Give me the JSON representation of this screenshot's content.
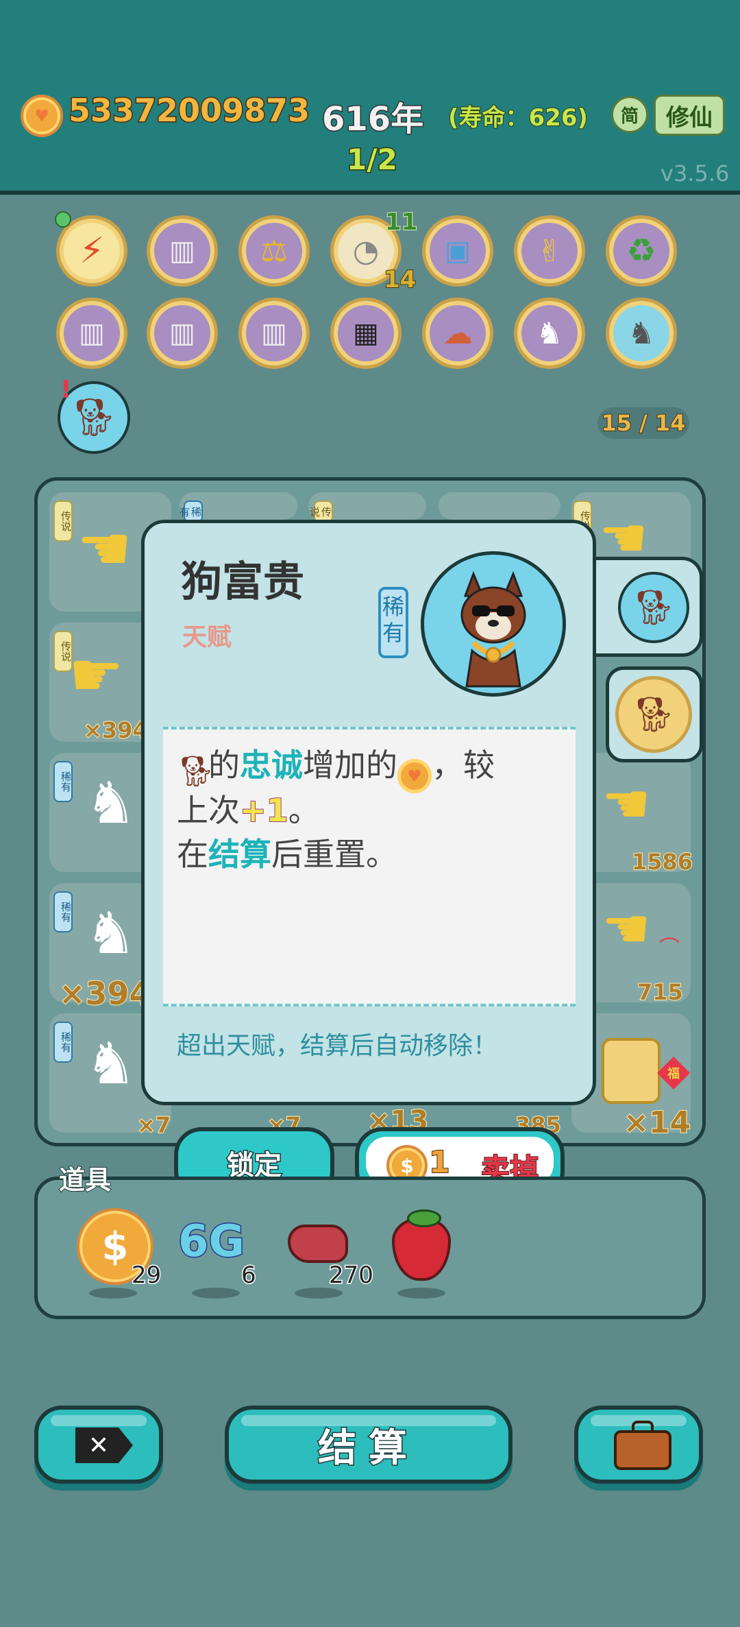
{
  "header": {
    "gold": "53372009873",
    "year": "616年",
    "lifespan": "(寿命：626)",
    "round": "1/2",
    "mode_icon": "简",
    "mode_button": "修仙",
    "version": "v3.5.6"
  },
  "relics": {
    "row1": [
      "lightning-icon",
      "skirt-icon",
      "balance-icon",
      "shell-icon",
      "tissue-icon",
      "rock-hand-icon",
      "recycle-icon"
    ],
    "row2": [
      "skirt-icon",
      "skirt-icon",
      "skirt-icon",
      "chip-icon",
      "mushroom-cloud-icon",
      "rabbit-icon",
      "husky-icon"
    ],
    "shell_top": "11",
    "shell_bottom": "14",
    "slot_count": "15 / 14"
  },
  "board": {
    "tags": {
      "legend": "传说",
      "rare": "稀有"
    },
    "counts": {
      "c1": "×394",
      "c2": "×394",
      "c3": "×7",
      "c4": "×7",
      "c5": "×13",
      "c6": "385",
      "c7": "×14",
      "c8": "1586",
      "c9": "715"
    }
  },
  "popup": {
    "title": "狗富贵",
    "subtitle": "天赋",
    "rarity": "稀有",
    "desc": {
      "l1_a": "的",
      "l1_b": "忠诚",
      "l1_c": "增加的",
      "l1_d": "，较",
      "l2_a": "上次",
      "l2_b": "+1",
      "l2_c": "。",
      "l3_a": "在",
      "l3_b": "结算",
      "l3_c": "后重置。"
    },
    "note": "超出天赋，结算后自动移除！"
  },
  "actions": {
    "lock": "锁定",
    "sell_price": "1",
    "sell": "卖掉"
  },
  "tools": {
    "label": "道具",
    "items": [
      {
        "icon": "dollar-coin-icon",
        "count": "29"
      },
      {
        "icon": "6g-icon",
        "text": "6G",
        "count": "6"
      },
      {
        "icon": "liver-icon",
        "count": "270"
      },
      {
        "icon": "strawberry-icon",
        "count": ""
      }
    ]
  },
  "bottom": {
    "settle": "结算"
  },
  "colors": {
    "background": "#5e8a8a",
    "header": "#227f7c",
    "accent": "#2dbdbd",
    "highlight": "#1cb3b9",
    "sell_text": "#e8364a"
  }
}
